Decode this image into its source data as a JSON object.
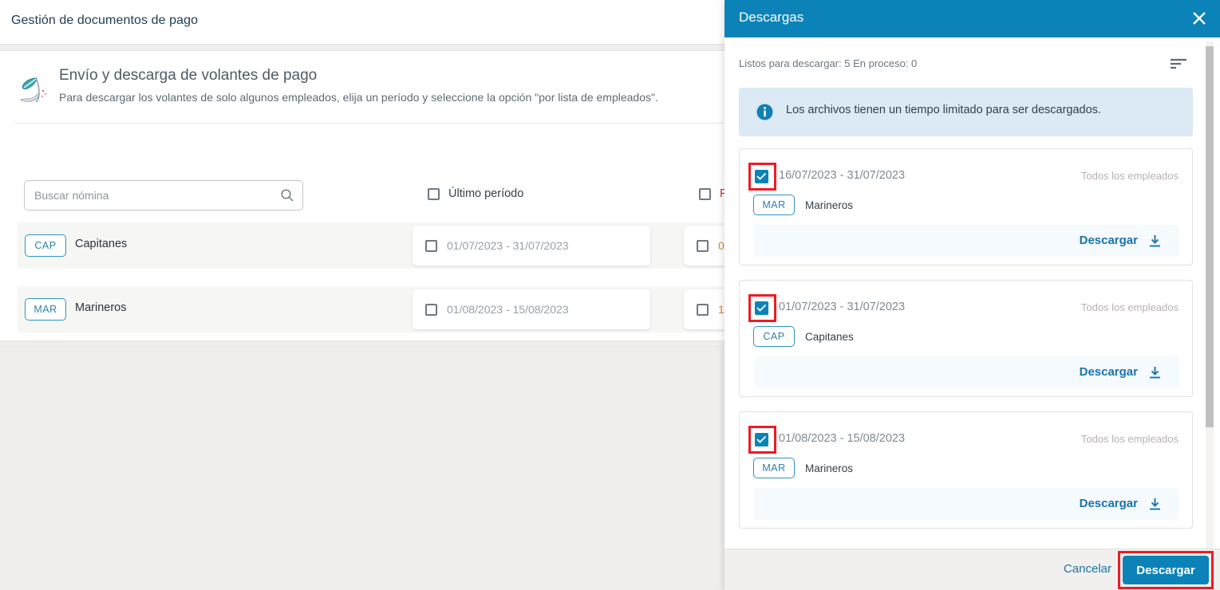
{
  "app": {
    "title": "Gestión de documentos de pago",
    "section": {
      "icon": "quill-scroll-icon",
      "title": "Envío y descarga de volantes de pago",
      "subtitle": "Para descargar los volantes de solo algunos empleados, elija un período y seleccione la opción \"por lista de empleados\"."
    },
    "search": {
      "placeholder": "Buscar nómina",
      "value": "",
      "icon": "search-icon"
    },
    "columns": [
      {
        "label": "Último período",
        "checked": false
      },
      {
        "label": "P",
        "checked": false
      }
    ],
    "rows": [
      {
        "code": "CAP",
        "name": "Capitanes",
        "period_1": "01/07/2023 - 31/07/2023",
        "period_1_checked": false,
        "period_2": "0",
        "period_2_checked": false
      },
      {
        "code": "MAR",
        "name": "Marineros",
        "period_1": "01/08/2023 - 15/08/2023",
        "period_1_checked": false,
        "period_2": "1",
        "period_2_checked": false
      }
    ]
  },
  "drawer": {
    "title": "Descargas",
    "close_icon": "close-icon",
    "sort_icon": "sort-icon",
    "meta": "Listos para descargar: 5   En proceso: 0",
    "ready_count": "5",
    "in_progress_count": "0",
    "info_banner": {
      "icon": "info-icon",
      "text": "Los archivos tienen un tiempo limitado para ser descargados."
    },
    "items": [
      {
        "checked": true,
        "range": "16/07/2023 - 31/07/2023",
        "scope": "Todos los empleados",
        "code": "MAR",
        "group": "Marineros",
        "action_label": "Descargar",
        "action_icon": "download-icon",
        "highlighted": true
      },
      {
        "checked": true,
        "range": "01/07/2023 - 31/07/2023",
        "scope": "Todos los empleados",
        "code": "CAP",
        "group": "Capitanes",
        "action_label": "Descargar",
        "action_icon": "download-icon",
        "highlighted": true
      },
      {
        "checked": true,
        "range": "01/08/2023 - 15/08/2023",
        "scope": "Todos los empleados",
        "code": "MAR",
        "group": "Marineros",
        "action_label": "Descargar",
        "action_icon": "download-icon",
        "highlighted": true
      }
    ],
    "footer": {
      "cancel_label": "Cancelar",
      "confirm_label": "Descargar",
      "confirm_highlighted": true
    }
  },
  "colors": {
    "brand_blue": "#0b83b8",
    "link_blue": "#1873ab",
    "badge_border": "#2f94bf",
    "highlight_red": "#ee1b24",
    "info_bg": "#dbeaf4",
    "page_bg": "#efeeec"
  }
}
